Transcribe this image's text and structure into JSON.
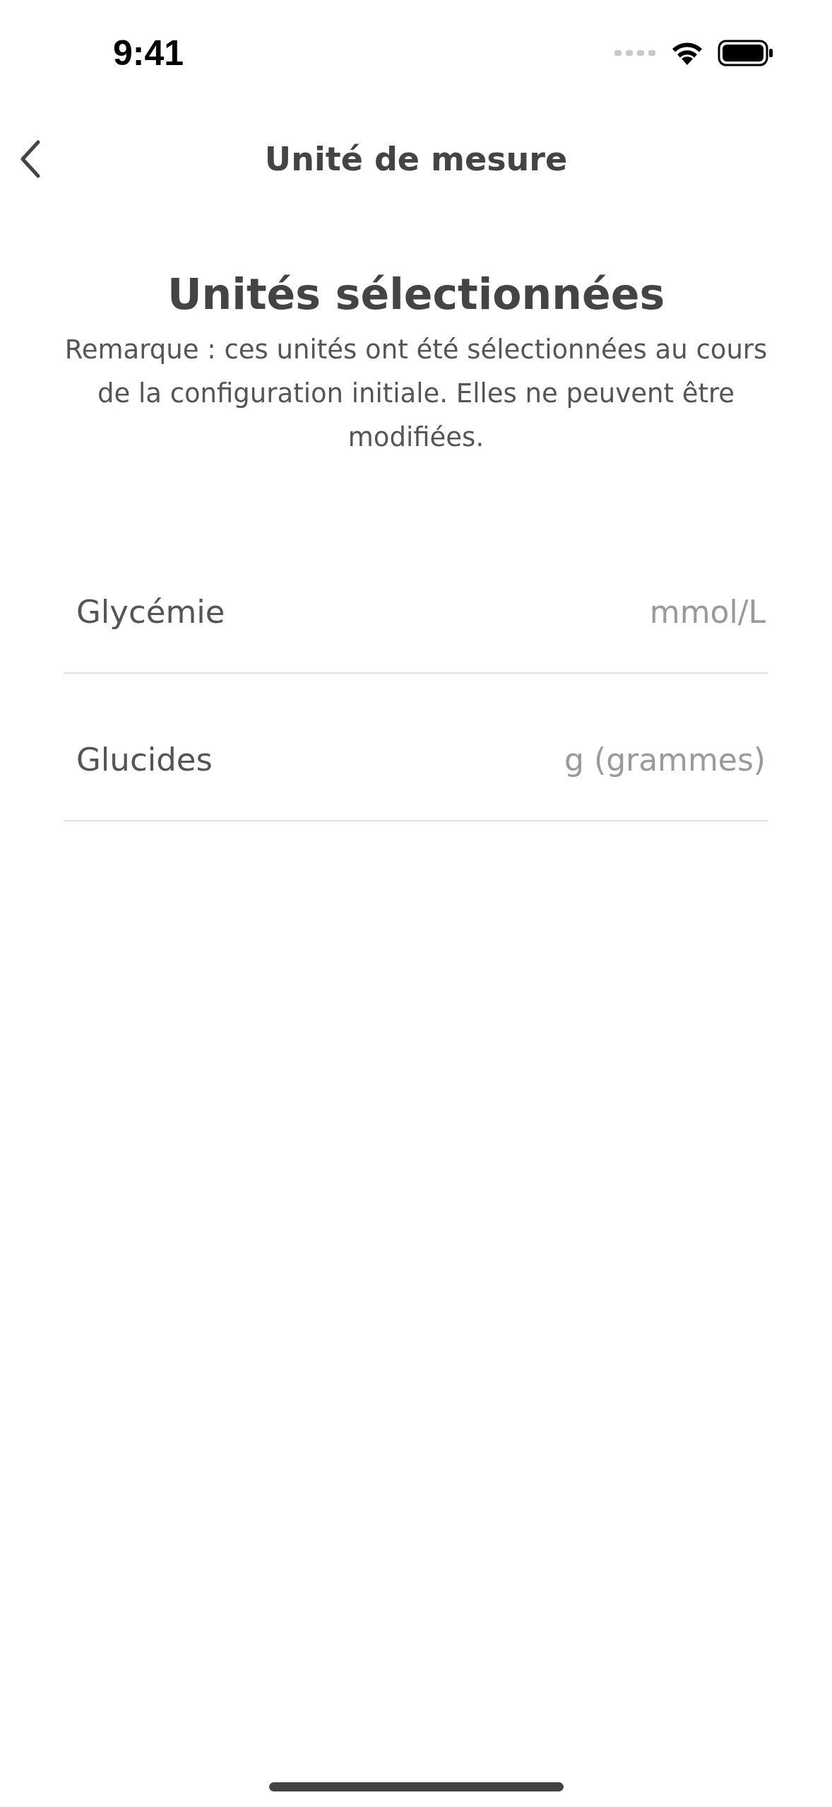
{
  "status_bar": {
    "time": "9:41"
  },
  "nav": {
    "title": "Unité de mesure"
  },
  "heading": "Unités sélectionnées",
  "note": "Remarque : ces unités ont été sélectionnées au cours de la configuration initiale. Elles ne peuvent être modifiées.",
  "rows": [
    {
      "label": "Glycémie",
      "value": "mmol/L"
    },
    {
      "label": "Glucides",
      "value": "g (grammes)"
    }
  ]
}
